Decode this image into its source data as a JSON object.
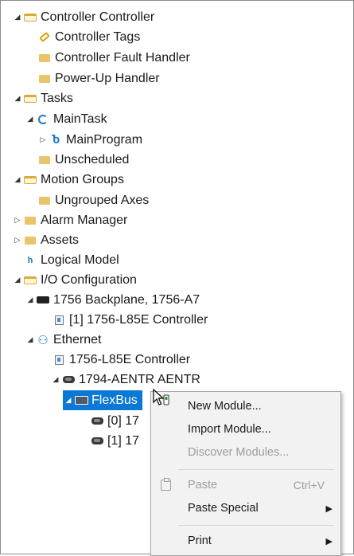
{
  "tree": {
    "controller": "Controller Controller",
    "controller_tags": "Controller Tags",
    "fault_handler": "Controller Fault Handler",
    "powerup_handler": "Power-Up Handler",
    "tasks": "Tasks",
    "main_task": "MainTask",
    "main_program": "MainProgram",
    "unscheduled": "Unscheduled",
    "motion_groups": "Motion Groups",
    "ungrouped_axes": "Ungrouped Axes",
    "alarm_manager": "Alarm Manager",
    "assets": "Assets",
    "logical_model": "Logical Model",
    "io_config": "I/O Configuration",
    "backplane": "1756 Backplane, 1756-A7",
    "backplane_controller": "[1] 1756-L85E Controller",
    "ethernet": "Ethernet",
    "eth_controller": "1756-L85E Controller",
    "aentr": "1794-AENTR AENTR",
    "flexbus": "FlexBus",
    "slot0": "[0] 17",
    "slot1": "[1] 17"
  },
  "context_menu": {
    "new_module": "New Module...",
    "import_module": "Import Module...",
    "discover_modules": "Discover Modules...",
    "paste": "Paste",
    "paste_shortcut": "Ctrl+V",
    "paste_special": "Paste Special",
    "print": "Print"
  },
  "icons": {
    "expanded": "triangle-down",
    "collapsed": "triangle-right",
    "submenu": "arrow-right"
  },
  "colors": {
    "selection": "#0a78d4",
    "folder": "#e9c46a",
    "menu_bg": "#f2f2f2",
    "disabled_text": "#9d9d9d"
  }
}
